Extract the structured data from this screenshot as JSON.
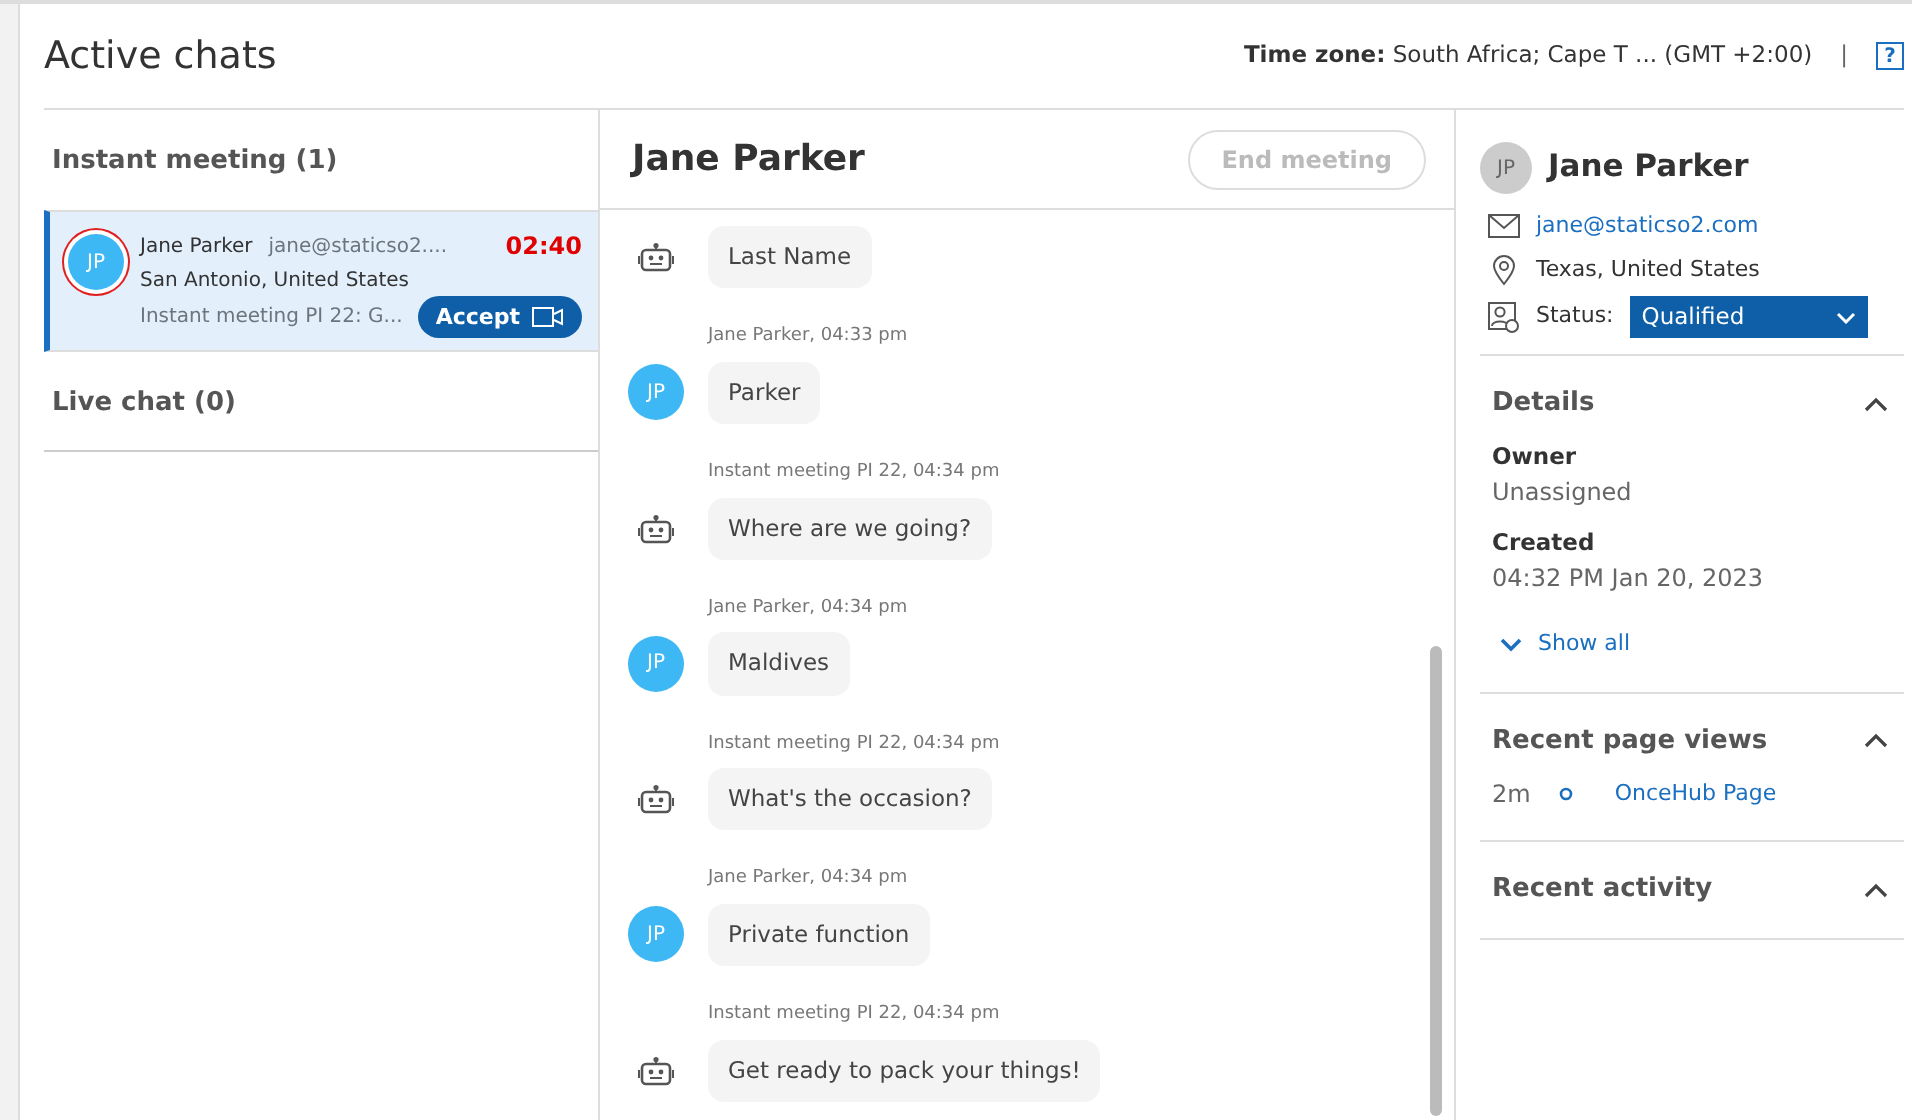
{
  "page": {
    "title": "Active chats",
    "timezone_label": "Time zone:",
    "timezone_value": "South Africa; Cape T ... (GMT +2:00)",
    "separator": "|",
    "help": "?"
  },
  "queues": [
    {
      "title": "Instant meeting (1)",
      "chats": [
        {
          "initials": "JP",
          "name": "Jane Parker",
          "email": "jane@staticso2....",
          "location": "San Antonio, United States",
          "subject": "Instant meeting PI 22: G...",
          "timer": "02:40",
          "accept": "Accept",
          "selected": true
        }
      ]
    },
    {
      "title": "Live chat (0)"
    }
  ],
  "conversation": {
    "name": "Jane Parker",
    "end_button": "End meeting",
    "end_disabled": true,
    "messages": [
      {
        "kind": "bot",
        "text": "Last Name"
      },
      {
        "kind": "user",
        "initials": "JP",
        "meta": "Jane Parker, 04:33 pm",
        "text": "Parker"
      },
      {
        "kind": "bot",
        "meta": "Instant meeting PI 22, 04:34 pm",
        "text": "Where are we going?"
      },
      {
        "kind": "user",
        "initials": "JP",
        "meta": "Jane Parker, 04:34 pm",
        "text": "Maldives"
      },
      {
        "kind": "bot",
        "meta": "Instant meeting PI 22, 04:34 pm",
        "text": "What's the occasion?"
      },
      {
        "kind": "user",
        "initials": "JP",
        "meta": "Jane Parker, 04:34 pm",
        "text": "Private function"
      },
      {
        "kind": "bot",
        "meta": "Instant meeting PI 22, 04:34 pm",
        "text": "Get ready to pack your things!"
      }
    ]
  },
  "contact": {
    "initials": "JP",
    "name": "Jane Parker",
    "email": "jane@staticso2.com",
    "location": "Texas, United States",
    "status_label": "Status:",
    "status": "Qualified",
    "sections": [
      {
        "title": "Details",
        "expanded": true,
        "fields": [
          {
            "label": "Owner",
            "value": "Unassigned"
          },
          {
            "label": "Created",
            "value": "04:32 PM Jan 20, 2023"
          }
        ],
        "show_all": "Show all"
      },
      {
        "title": "Recent page views",
        "expanded": true,
        "views": [
          {
            "time": "2m",
            "page": "OnceHub Page"
          }
        ]
      },
      {
        "title": "Recent activity",
        "expanded": true
      }
    ]
  }
}
